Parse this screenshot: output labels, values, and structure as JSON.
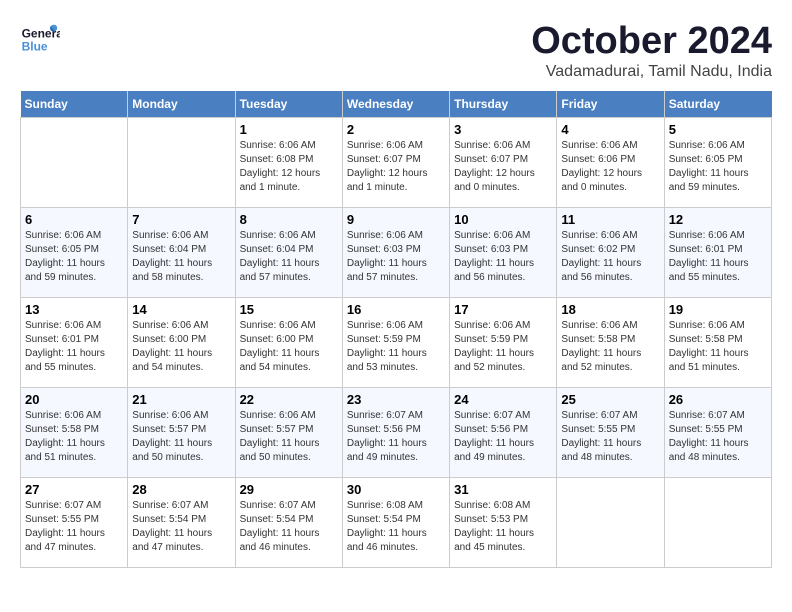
{
  "header": {
    "logo": {
      "general": "General",
      "blue": "Blue"
    },
    "title": "October 2024",
    "location": "Vadamadurai, Tamil Nadu, India"
  },
  "columns": [
    "Sunday",
    "Monday",
    "Tuesday",
    "Wednesday",
    "Thursday",
    "Friday",
    "Saturday"
  ],
  "weeks": [
    [
      {
        "day": "",
        "info": ""
      },
      {
        "day": "",
        "info": ""
      },
      {
        "day": "1",
        "sunrise": "Sunrise: 6:06 AM",
        "sunset": "Sunset: 6:08 PM",
        "daylight": "Daylight: 12 hours and 1 minute."
      },
      {
        "day": "2",
        "sunrise": "Sunrise: 6:06 AM",
        "sunset": "Sunset: 6:07 PM",
        "daylight": "Daylight: 12 hours and 1 minute."
      },
      {
        "day": "3",
        "sunrise": "Sunrise: 6:06 AM",
        "sunset": "Sunset: 6:07 PM",
        "daylight": "Daylight: 12 hours and 0 minutes."
      },
      {
        "day": "4",
        "sunrise": "Sunrise: 6:06 AM",
        "sunset": "Sunset: 6:06 PM",
        "daylight": "Daylight: 12 hours and 0 minutes."
      },
      {
        "day": "5",
        "sunrise": "Sunrise: 6:06 AM",
        "sunset": "Sunset: 6:05 PM",
        "daylight": "Daylight: 11 hours and 59 minutes."
      }
    ],
    [
      {
        "day": "6",
        "sunrise": "Sunrise: 6:06 AM",
        "sunset": "Sunset: 6:05 PM",
        "daylight": "Daylight: 11 hours and 59 minutes."
      },
      {
        "day": "7",
        "sunrise": "Sunrise: 6:06 AM",
        "sunset": "Sunset: 6:04 PM",
        "daylight": "Daylight: 11 hours and 58 minutes."
      },
      {
        "day": "8",
        "sunrise": "Sunrise: 6:06 AM",
        "sunset": "Sunset: 6:04 PM",
        "daylight": "Daylight: 11 hours and 57 minutes."
      },
      {
        "day": "9",
        "sunrise": "Sunrise: 6:06 AM",
        "sunset": "Sunset: 6:03 PM",
        "daylight": "Daylight: 11 hours and 57 minutes."
      },
      {
        "day": "10",
        "sunrise": "Sunrise: 6:06 AM",
        "sunset": "Sunset: 6:03 PM",
        "daylight": "Daylight: 11 hours and 56 minutes."
      },
      {
        "day": "11",
        "sunrise": "Sunrise: 6:06 AM",
        "sunset": "Sunset: 6:02 PM",
        "daylight": "Daylight: 11 hours and 56 minutes."
      },
      {
        "day": "12",
        "sunrise": "Sunrise: 6:06 AM",
        "sunset": "Sunset: 6:01 PM",
        "daylight": "Daylight: 11 hours and 55 minutes."
      }
    ],
    [
      {
        "day": "13",
        "sunrise": "Sunrise: 6:06 AM",
        "sunset": "Sunset: 6:01 PM",
        "daylight": "Daylight: 11 hours and 55 minutes."
      },
      {
        "day": "14",
        "sunrise": "Sunrise: 6:06 AM",
        "sunset": "Sunset: 6:00 PM",
        "daylight": "Daylight: 11 hours and 54 minutes."
      },
      {
        "day": "15",
        "sunrise": "Sunrise: 6:06 AM",
        "sunset": "Sunset: 6:00 PM",
        "daylight": "Daylight: 11 hours and 54 minutes."
      },
      {
        "day": "16",
        "sunrise": "Sunrise: 6:06 AM",
        "sunset": "Sunset: 5:59 PM",
        "daylight": "Daylight: 11 hours and 53 minutes."
      },
      {
        "day": "17",
        "sunrise": "Sunrise: 6:06 AM",
        "sunset": "Sunset: 5:59 PM",
        "daylight": "Daylight: 11 hours and 52 minutes."
      },
      {
        "day": "18",
        "sunrise": "Sunrise: 6:06 AM",
        "sunset": "Sunset: 5:58 PM",
        "daylight": "Daylight: 11 hours and 52 minutes."
      },
      {
        "day": "19",
        "sunrise": "Sunrise: 6:06 AM",
        "sunset": "Sunset: 5:58 PM",
        "daylight": "Daylight: 11 hours and 51 minutes."
      }
    ],
    [
      {
        "day": "20",
        "sunrise": "Sunrise: 6:06 AM",
        "sunset": "Sunset: 5:58 PM",
        "daylight": "Daylight: 11 hours and 51 minutes."
      },
      {
        "day": "21",
        "sunrise": "Sunrise: 6:06 AM",
        "sunset": "Sunset: 5:57 PM",
        "daylight": "Daylight: 11 hours and 50 minutes."
      },
      {
        "day": "22",
        "sunrise": "Sunrise: 6:06 AM",
        "sunset": "Sunset: 5:57 PM",
        "daylight": "Daylight: 11 hours and 50 minutes."
      },
      {
        "day": "23",
        "sunrise": "Sunrise: 6:07 AM",
        "sunset": "Sunset: 5:56 PM",
        "daylight": "Daylight: 11 hours and 49 minutes."
      },
      {
        "day": "24",
        "sunrise": "Sunrise: 6:07 AM",
        "sunset": "Sunset: 5:56 PM",
        "daylight": "Daylight: 11 hours and 49 minutes."
      },
      {
        "day": "25",
        "sunrise": "Sunrise: 6:07 AM",
        "sunset": "Sunset: 5:55 PM",
        "daylight": "Daylight: 11 hours and 48 minutes."
      },
      {
        "day": "26",
        "sunrise": "Sunrise: 6:07 AM",
        "sunset": "Sunset: 5:55 PM",
        "daylight": "Daylight: 11 hours and 48 minutes."
      }
    ],
    [
      {
        "day": "27",
        "sunrise": "Sunrise: 6:07 AM",
        "sunset": "Sunset: 5:55 PM",
        "daylight": "Daylight: 11 hours and 47 minutes."
      },
      {
        "day": "28",
        "sunrise": "Sunrise: 6:07 AM",
        "sunset": "Sunset: 5:54 PM",
        "daylight": "Daylight: 11 hours and 47 minutes."
      },
      {
        "day": "29",
        "sunrise": "Sunrise: 6:07 AM",
        "sunset": "Sunset: 5:54 PM",
        "daylight": "Daylight: 11 hours and 46 minutes."
      },
      {
        "day": "30",
        "sunrise": "Sunrise: 6:08 AM",
        "sunset": "Sunset: 5:54 PM",
        "daylight": "Daylight: 11 hours and 46 minutes."
      },
      {
        "day": "31",
        "sunrise": "Sunrise: 6:08 AM",
        "sunset": "Sunset: 5:53 PM",
        "daylight": "Daylight: 11 hours and 45 minutes."
      },
      {
        "day": "",
        "info": ""
      },
      {
        "day": "",
        "info": ""
      }
    ]
  ]
}
